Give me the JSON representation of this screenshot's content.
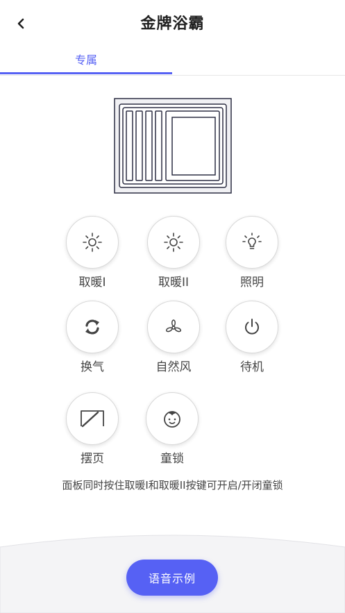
{
  "header": {
    "title": "金牌浴霸"
  },
  "tabs": [
    {
      "label": "专属",
      "active": true
    }
  ],
  "controls": [
    {
      "name": "heat-1",
      "label": "取暖I",
      "icon": "sun-icon"
    },
    {
      "name": "heat-2",
      "label": "取暖II",
      "icon": "sun-icon"
    },
    {
      "name": "light",
      "label": "照明",
      "icon": "bulb-icon"
    },
    {
      "name": "air-exchange",
      "label": "换气",
      "icon": "refresh-icon"
    },
    {
      "name": "natural-wind",
      "label": "自然风",
      "icon": "fan-icon"
    },
    {
      "name": "standby",
      "label": "待机",
      "icon": "power-icon"
    },
    {
      "name": "swing",
      "label": "摆页",
      "icon": "swing-icon"
    },
    {
      "name": "child-lock",
      "label": "童锁",
      "icon": "baby-icon"
    }
  ],
  "hint": "面板同时按住取暖I和取暖II按键可开启/开闭童锁",
  "voice_button": {
    "label": "语音示例"
  },
  "colors": {
    "accent": "#5661f4",
    "title": "#1f1f1f",
    "icon": "#444444"
  }
}
